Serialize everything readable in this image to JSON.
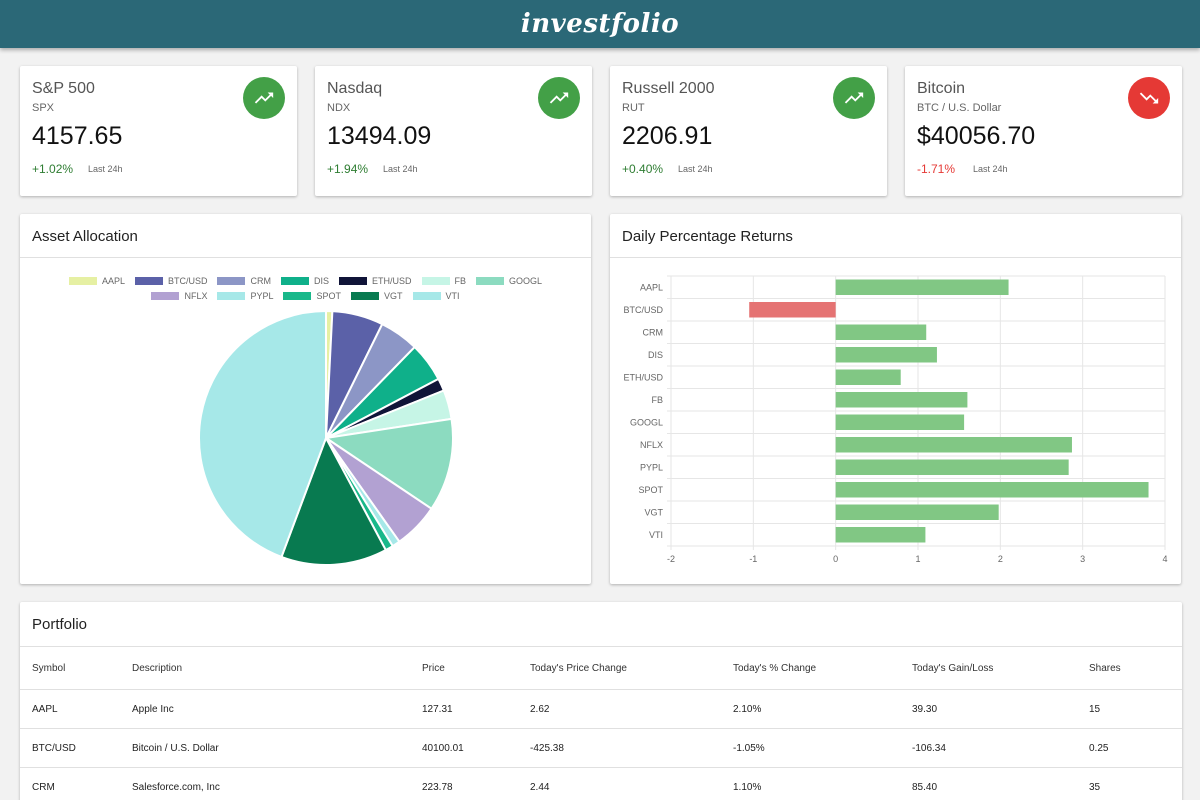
{
  "app": {
    "logo": "investfolio"
  },
  "tickers": [
    {
      "name": "S&P 500",
      "symbol": "SPX",
      "value": "4157.65",
      "change": "+1.02%",
      "period": "Last 24h",
      "trend": "up",
      "icon": "trending-up-icon"
    },
    {
      "name": "Nasdaq",
      "symbol": "NDX",
      "value": "13494.09",
      "change": "+1.94%",
      "period": "Last 24h",
      "trend": "up",
      "icon": "trending-up-icon"
    },
    {
      "name": "Russell 2000",
      "symbol": "RUT",
      "value": "2206.91",
      "change": "+0.40%",
      "period": "Last 24h",
      "trend": "up",
      "icon": "trending-up-icon"
    },
    {
      "name": "Bitcoin",
      "symbol": "BTC / U.S. Dollar",
      "value": "$40056.70",
      "change": "-1.71%",
      "period": "Last 24h",
      "trend": "down",
      "icon": "trending-down-icon"
    }
  ],
  "colors": {
    "up": "#43a047",
    "down": "#e53935",
    "bar_positive": "#81c784",
    "bar_negative": "#e57373",
    "header": "#2b6877"
  },
  "allocation": {
    "title": "Asset Allocation",
    "chart_data": {
      "type": "pie",
      "labels": [
        "AAPL",
        "BTC/USD",
        "CRM",
        "DIS",
        "ETH/USD",
        "FB",
        "GOOGL",
        "NFLX",
        "PYPL",
        "SPOT",
        "VGT",
        "VTI"
      ],
      "values": [
        0.8,
        6.5,
        5.0,
        5.0,
        1.6,
        3.7,
        11.8,
        5.8,
        1.0,
        1.0,
        13.5,
        44.3
      ],
      "colors": [
        "#e6f0a3",
        "#5b61a8",
        "#8c96c6",
        "#0fb08a",
        "#101438",
        "#c6f5e6",
        "#8cdbc0",
        "#b2a1d2",
        "#a6e8e8",
        "#19b88a",
        "#087a50",
        "#a6e8e8"
      ],
      "legend_position": "top-center"
    }
  },
  "returns": {
    "title": "Daily Percentage Returns",
    "chart_data": {
      "type": "bar",
      "orientation": "horizontal",
      "categories": [
        "AAPL",
        "BTC/USD",
        "CRM",
        "DIS",
        "ETH/USD",
        "FB",
        "GOOGL",
        "NFLX",
        "PYPL",
        "SPOT",
        "VGT",
        "VTI"
      ],
      "values": [
        2.1,
        -1.05,
        1.1,
        1.23,
        0.79,
        1.6,
        1.56,
        2.87,
        2.83,
        3.8,
        1.98,
        1.09
      ],
      "xlim": [
        -2,
        4
      ],
      "xticks": [
        "-2",
        "-1",
        "0",
        "1",
        "2",
        "3",
        "4"
      ],
      "grid": true
    }
  },
  "portfolio": {
    "title": "Portfolio",
    "columns": [
      "Symbol",
      "Description",
      "Price",
      "Today's Price Change",
      "Today's % Change",
      "Today's Gain/Loss",
      "Shares"
    ],
    "rows": [
      [
        "AAPL",
        "Apple Inc",
        "127.31",
        "2.62",
        "2.10%",
        "39.30",
        "15"
      ],
      [
        "BTC/USD",
        "Bitcoin / U.S. Dollar",
        "40100.01",
        "-425.38",
        "-1.05%",
        "-106.34",
        "0.25"
      ],
      [
        "CRM",
        "Salesforce.com, Inc",
        "223.78",
        "2.44",
        "1.10%",
        "85.40",
        "35"
      ]
    ]
  }
}
